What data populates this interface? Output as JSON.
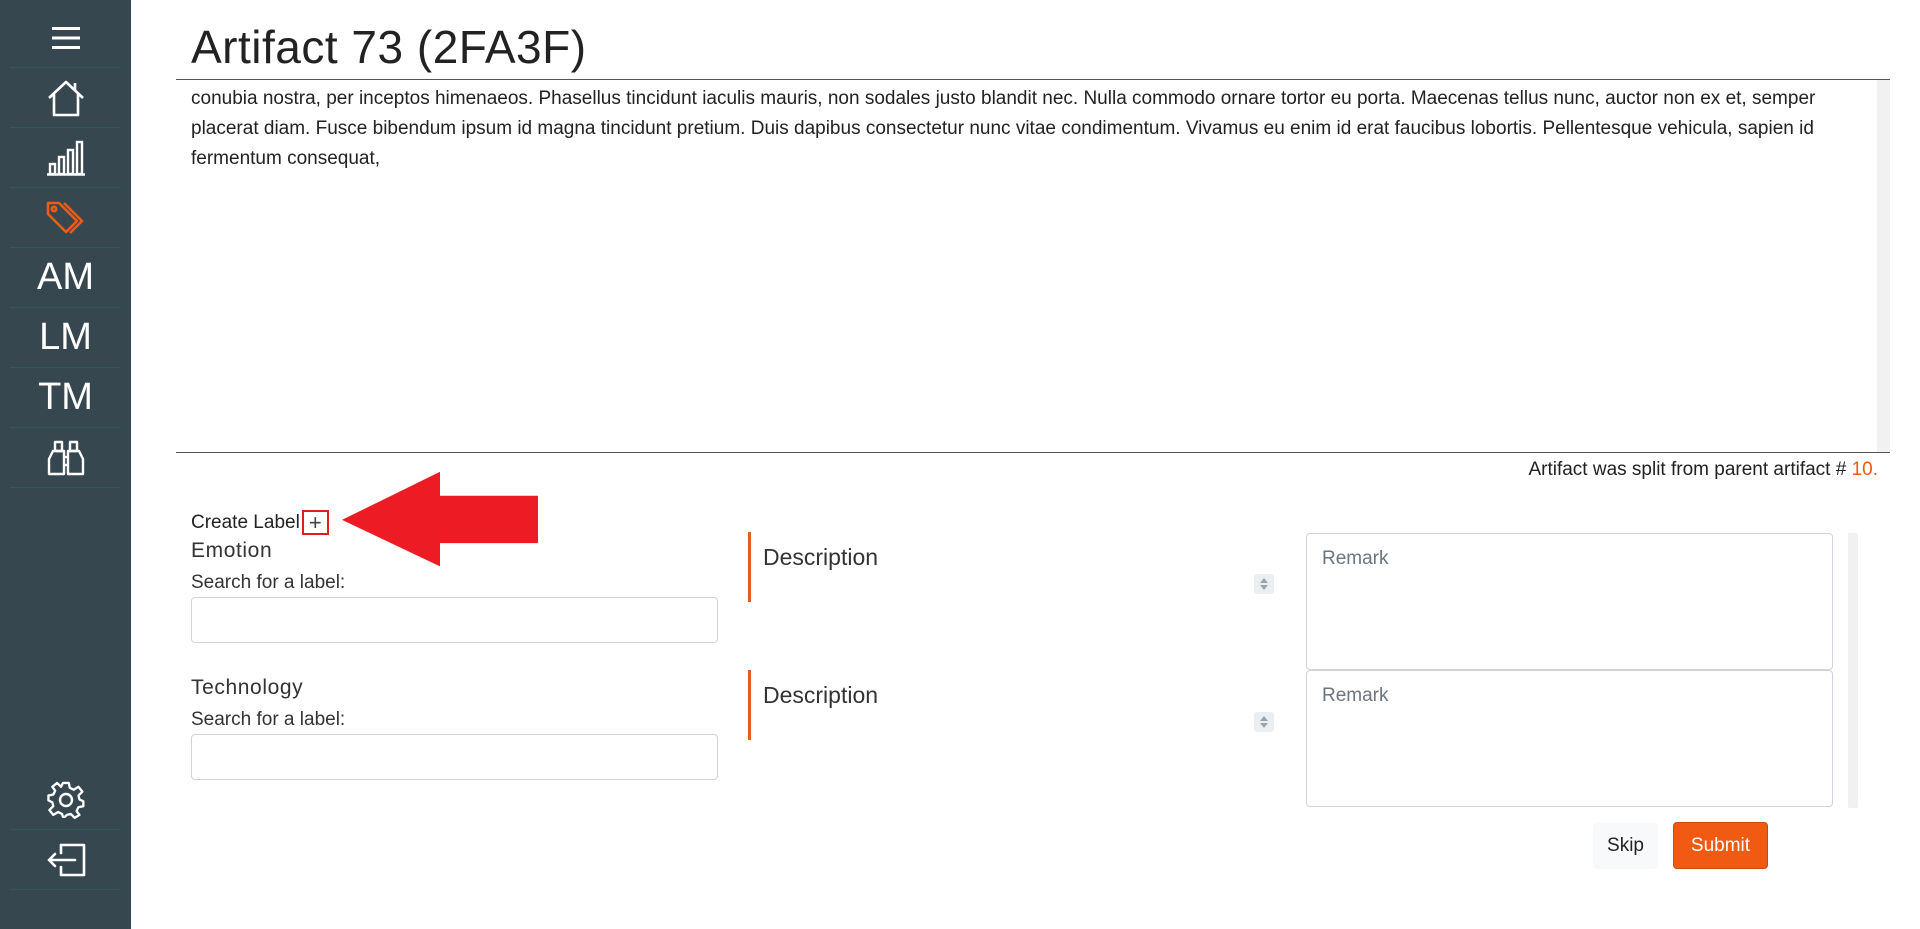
{
  "sidebar": {
    "items": [
      {
        "icon": "menu-icon"
      },
      {
        "icon": "home-icon"
      },
      {
        "icon": "bar-chart-icon"
      },
      {
        "icon": "tags-icon",
        "active": true
      },
      {
        "label": "AM"
      },
      {
        "label": "LM"
      },
      {
        "label": "TM"
      },
      {
        "icon": "binoculars-icon"
      },
      {
        "icon": "gear-icon"
      },
      {
        "icon": "logout-icon"
      }
    ],
    "active_color": "#f05a12",
    "background": "#37474f"
  },
  "header": {
    "title": "Artifact 73 (2FA3F)"
  },
  "artifact": {
    "text": "conubia nostra, per inceptos himenaeos. Phasellus tincidunt iaculis mauris, non sodales justo blandit nec. Nulla commodo ornare tortor eu porta. Maecenas tellus nunc, auctor non ex et, semper placerat diam. Fusce bibendum ipsum id magna tincidunt pretium. Duis dapibus consectetur nunc vitae condimentum. Vivamus eu enim id erat faucibus lobortis. Pellentesque vehicula, sapien id fermentum consequat,",
    "split_note": "Artifact was split from parent artifact #",
    "parent_link": "10."
  },
  "create_label": {
    "text": "Create Label",
    "plus": "+"
  },
  "labels": [
    {
      "name": "Emotion",
      "search_label": "Search for a label:",
      "search_value": "",
      "description": "Description",
      "remark_placeholder": "Remark"
    },
    {
      "name": "Technology",
      "search_label": "Search for a label:",
      "search_value": "",
      "description": "Description",
      "remark_placeholder": "Remark"
    }
  ],
  "actions": {
    "skip": "Skip",
    "submit": "Submit",
    "submit_color": "#f05a12"
  }
}
